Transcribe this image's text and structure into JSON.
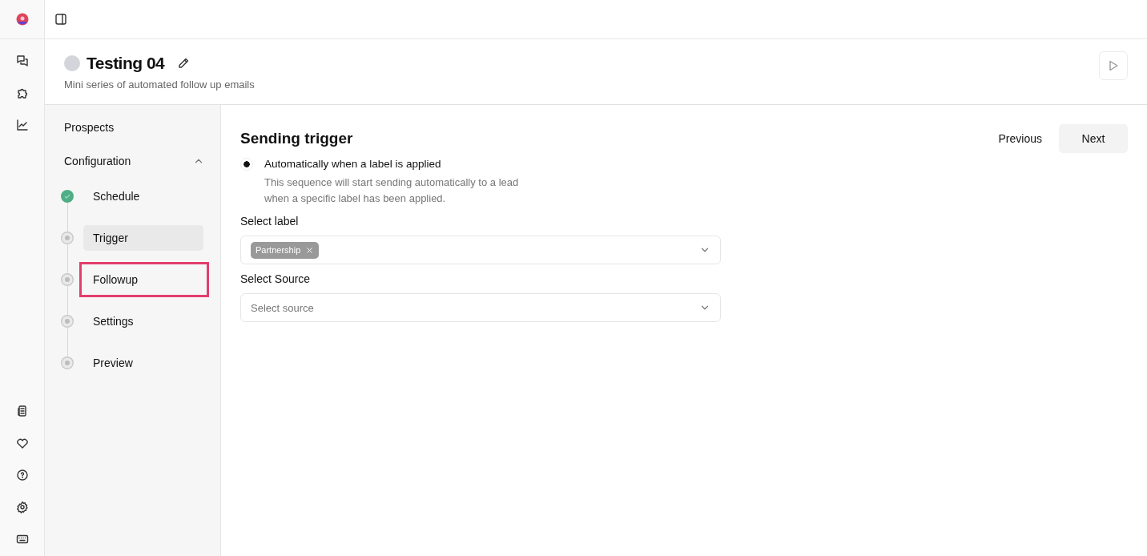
{
  "header": {
    "title": "Testing 04",
    "subtitle": "Mini series of automated follow up emails"
  },
  "nav": {
    "prospects": "Prospects",
    "configuration": {
      "label": "Configuration",
      "expanded": true,
      "steps": [
        {
          "label": "Schedule",
          "done": true,
          "selected": false,
          "highlighted": false
        },
        {
          "label": "Trigger",
          "done": false,
          "selected": true,
          "highlighted": false
        },
        {
          "label": "Followup",
          "done": false,
          "selected": false,
          "highlighted": true
        },
        {
          "label": "Settings",
          "done": false,
          "selected": false,
          "highlighted": false
        },
        {
          "label": "Preview",
          "done": false,
          "selected": false,
          "highlighted": false
        }
      ]
    }
  },
  "content": {
    "title": "Sending trigger",
    "buttons": [
      "Previous",
      "Next"
    ],
    "option": {
      "label": "Automatically when a label is applied",
      "selected": true,
      "description": "This sequence will start sending automatically to a lead when a specific label has been applied."
    },
    "fields": [
      {
        "label": "Select label",
        "tags": [
          "Partnership"
        ]
      },
      {
        "label": "Select Source",
        "placeholder": "Select source"
      }
    ]
  }
}
